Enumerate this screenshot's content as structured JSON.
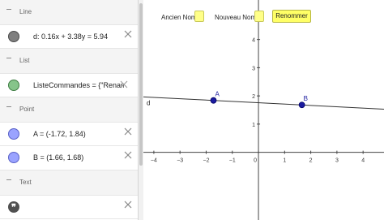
{
  "algebra": {
    "categories": [
      {
        "label": "Line"
      },
      {
        "label": "List"
      },
      {
        "label": "Point"
      },
      {
        "label": "Text"
      }
    ],
    "line_d": "d: 0.16x + 3.38y = 5.94",
    "list_cmd": "ListeCommandes = {\"Rename[,\"}",
    "point_a": "A = (-1.72, 1.84)",
    "point_b": "B = (1.66, 1.68)",
    "text_value": ""
  },
  "graphics": {
    "old_name_label": "Ancien Nom",
    "new_name_label": "Nouveau Nom",
    "rename_button": "Renommer",
    "line_label": "d",
    "point_a_label": "A",
    "point_b_label": "B",
    "x_ticks": [
      "−4",
      "−3",
      "−2",
      "−1",
      "0",
      "1",
      "2",
      "3",
      "4"
    ],
    "y_ticks": [
      "4",
      "3",
      "2",
      "1"
    ],
    "x_range": [
      -4.4,
      4.8
    ],
    "y_range": [
      -2.4,
      5.4
    ],
    "line": {
      "a": 0.16,
      "b": 3.38,
      "c": 5.94
    },
    "point_a": {
      "x": -1.72,
      "y": 1.84
    },
    "point_b": {
      "x": 1.66,
      "y": 1.68
    },
    "colors": {
      "point": "#1b1b9f",
      "line": "#333333",
      "axis": "#444444",
      "input": "#ffff88",
      "button": "#ffff66"
    }
  }
}
